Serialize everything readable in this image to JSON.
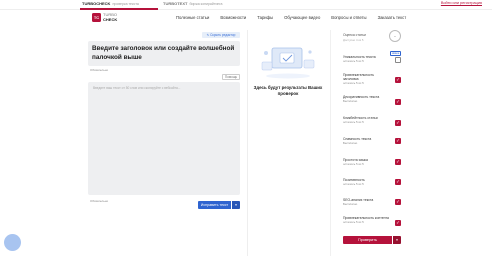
{
  "brand_tabs": {
    "active": {
      "name": "TURBOCHECK",
      "sub": "проверка текста"
    },
    "other": {
      "name": "TURBOTEXT",
      "sub": "биржа копирайтинга"
    },
    "login": "Войти или регистрация"
  },
  "logo": {
    "mark": "TC",
    "line1": "TURBO",
    "line2": "CHECK"
  },
  "nav": [
    "Полезные статьи",
    "Возможности",
    "Тарифы",
    "Обучающее видео",
    "Вопросы и ответы",
    "Заказать текст"
  ],
  "editor": {
    "advanced_label": "✎ Скрыть редактор",
    "title_placeholder": "Введите заголовок или создайте волшебной палочкой выше",
    "required_label": "Обязательно",
    "help_label": "Помощь",
    "text_placeholder": "Введите ваш текст от 50 слов или скопируйте с вебсайта...",
    "required_label_2": "Обязательно",
    "check_label": "Исправить текст",
    "check_dropdown": "▾"
  },
  "results": {
    "message": "Здесь будут результаты Ваших проверок"
  },
  "panel": {
    "overall_label": "Оценка статьи",
    "overall_sub": "Доступно 4 из 5",
    "gauge_value": "–",
    "new_badge": "Новое",
    "criteria": [
      {
        "name": "Уникальность текста",
        "status": "осталось 5 из 5",
        "checked": false
      },
      {
        "name": "Привлекательность заголовка",
        "status": "осталось 5 из 5",
        "checked": true
      },
      {
        "name": "Декоративность текста",
        "status": "Бесплатно",
        "checked": true
      },
      {
        "name": "Кликбейтность статьи",
        "status": "осталось 5 из 5",
        "checked": true
      },
      {
        "name": "Спамность текста",
        "status": "Бесплатно",
        "checked": true
      },
      {
        "name": "Простота языка",
        "status": "осталось 5 из 5",
        "checked": true
      },
      {
        "name": "Позитивность",
        "status": "осталось 5 из 5",
        "checked": true
      },
      {
        "name": "SEO-анализ текста",
        "status": "Бесплатно",
        "checked": true
      },
      {
        "name": "Привлекательность контента",
        "status": "осталось 5 из 5",
        "checked": true
      }
    ],
    "run_label": "Проверить",
    "run_dropdown": "▾"
  },
  "colors": {
    "accent": "#b5123b",
    "primary_blue": "#2f64d0",
    "field_bg": "#eeeff1"
  }
}
